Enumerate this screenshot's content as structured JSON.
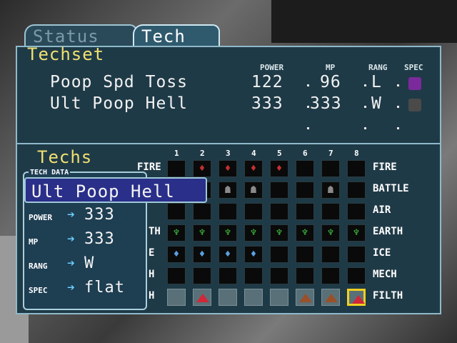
{
  "tabs": [
    {
      "label": "Status"
    },
    {
      "label": "Tech"
    }
  ],
  "techset": {
    "title": "Techset",
    "headers": {
      "power": "POWER",
      "mp": "MP",
      "range": "RANG",
      "spec": "SPEC"
    },
    "rows": [
      {
        "name": "Poop Spd Toss",
        "power": "122",
        "mp": "96",
        "range": "L",
        "spec_icon": "purple-skull-icon"
      },
      {
        "name": "Ult Poop Hell",
        "power": "333",
        "mp": "333",
        "range": "W",
        "spec_icon": "grey-skull-icon"
      }
    ]
  },
  "techs": {
    "title": "Techs",
    "columns": [
      "1",
      "2",
      "3",
      "4",
      "5",
      "6",
      "7",
      "8"
    ],
    "elements_right": [
      "FIRE",
      "BATTLE",
      "AIR",
      "EARTH",
      "ICE",
      "MECH",
      "FILTH"
    ],
    "elements_left_visible": [
      "FIRE",
      "",
      "",
      "TH",
      "E",
      "H",
      "H"
    ],
    "grid": [
      [
        "empty",
        "fire",
        "fire",
        "fire",
        "fire",
        "empty",
        "empty",
        "empty"
      ],
      [
        "empty",
        "empty",
        "battle",
        "battle",
        "empty",
        "empty",
        "battle",
        "empty"
      ],
      [
        "empty",
        "empty",
        "empty",
        "empty",
        "empty",
        "empty",
        "empty",
        "empty"
      ],
      [
        "earth",
        "earth",
        "earth",
        "earth",
        "earth",
        "earth",
        "earth",
        "earth"
      ],
      [
        "ice",
        "ice",
        "ice",
        "ice",
        "empty",
        "empty",
        "empty",
        "empty"
      ],
      [
        "empty",
        "empty",
        "empty",
        "empty",
        "empty",
        "empty",
        "empty",
        "empty"
      ],
      [
        "grey",
        "red-tri",
        "grey",
        "grey",
        "grey",
        "brown-tri",
        "brown-tri",
        "red-tri-selected"
      ]
    ]
  },
  "tech_data": {
    "label": "TECH DATA",
    "name": "Ult Poop Hell",
    "rows": [
      {
        "label": "POWER",
        "value": "333"
      },
      {
        "label": "MP",
        "value": "333"
      },
      {
        "label": "RANG",
        "value": "W"
      },
      {
        "label": "SPEC",
        "value": "flat"
      }
    ]
  },
  "colors": {
    "accent_title": "#f0e070",
    "panel_bg": "#1f3a47",
    "selected_border": "#f0d020"
  }
}
